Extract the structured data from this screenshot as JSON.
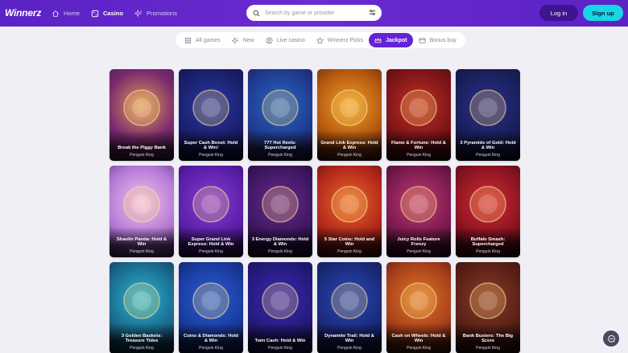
{
  "header": {
    "logo": "Winnerz",
    "nav": [
      {
        "label": "Home",
        "icon": "home-icon",
        "active": false
      },
      {
        "label": "Casino",
        "icon": "casino-icon",
        "active": true
      },
      {
        "label": "Promotions",
        "icon": "sparkle-icon",
        "active": false
      }
    ],
    "search_placeholder": "Search by game or provider",
    "login_label": "Log in",
    "signup_label": "Sign up"
  },
  "tabs": [
    {
      "label": "All games",
      "icon": "grid-icon",
      "active": false
    },
    {
      "label": "New",
      "icon": "sparkle-icon",
      "active": false
    },
    {
      "label": "Live casino",
      "icon": "live-icon",
      "active": false
    },
    {
      "label": "Winnerz Picks",
      "icon": "star-icon",
      "active": false
    },
    {
      "label": "Jackpot",
      "icon": "crown-icon",
      "active": true
    },
    {
      "label": "Bonus buy",
      "icon": "card-icon",
      "active": false
    }
  ],
  "games": [
    {
      "title": "Break the Piggy Bank",
      "provider": "Penguin King",
      "colors": [
        "#e09a5a",
        "#7a2a6e",
        "#3d1a4a"
      ]
    },
    {
      "title": "Super Cash Boost: Hold & Win!",
      "provider": "Penguin King",
      "colors": [
        "#2b3aa8",
        "#1a1f6b",
        "#10113c"
      ]
    },
    {
      "title": "777 Hot Reels: Supercharged",
      "provider": "Penguin King",
      "colors": [
        "#2a68c8",
        "#1f3b8e",
        "#2a1240"
      ]
    },
    {
      "title": "Grand Link Express: Hold & Win",
      "provider": "Penguin King",
      "colors": [
        "#f2a12a",
        "#b4570f",
        "#4a1d0a"
      ]
    },
    {
      "title": "Flame & Fortune: Hold & Win",
      "provider": "Penguin King",
      "colors": [
        "#c23226",
        "#7d1418",
        "#3a0a0c"
      ]
    },
    {
      "title": "3 Pyramids of Gold: Hold & Win",
      "provider": "Penguin King",
      "colors": [
        "#2e2e8a",
        "#18205a",
        "#0e1233"
      ]
    },
    {
      "title": "Shaolin Panda: Hold & Win",
      "provider": "Penguin King",
      "colors": [
        "#f2c2ec",
        "#b57ad6",
        "#4b2a75"
      ]
    },
    {
      "title": "Super Grand Link Express: Hold & Win",
      "provider": "Penguin King",
      "colors": [
        "#8a3dd6",
        "#5a1fa8",
        "#2a0f5c"
      ]
    },
    {
      "title": "3 Energy Diamonds: Hold & Win",
      "provider": "Penguin King",
      "colors": [
        "#6b2a8e",
        "#3d1760",
        "#1b0a33"
      ]
    },
    {
      "title": "5 Star Coins: Hold and Win",
      "provider": "Penguin King",
      "colors": [
        "#e86a2a",
        "#b3281a",
        "#4a0a0a"
      ]
    },
    {
      "title": "Juicy Rolls Feature Frenzy",
      "provider": "Penguin King",
      "colors": [
        "#c23a72",
        "#7a1a4e",
        "#2a0a22"
      ]
    },
    {
      "title": "Buffalo Smash: Supercharged",
      "provider": "Penguin King",
      "colors": [
        "#d62a3a",
        "#8a1420",
        "#3a0a10"
      ]
    },
    {
      "title": "3 Golden Baskets: Treasure Tides",
      "provider": "Penguin King",
      "colors": [
        "#2ab8d6",
        "#1a6a8e",
        "#0e2a3c"
      ]
    },
    {
      "title": "Coins & Diamonds: Hold & Win",
      "provider": "Penguin King",
      "colors": [
        "#2a5fd6",
        "#1a3a9e",
        "#0c1a4a"
      ]
    },
    {
      "title": "Twin Cash: Hold & Win",
      "provider": "Penguin King",
      "colors": [
        "#3a2ab8",
        "#241a7a",
        "#120c3c"
      ]
    },
    {
      "title": "Dynamite Trail: Hold & Win",
      "provider": "Penguin King",
      "colors": [
        "#2a4ab8",
        "#1a2a7a",
        "#0e143c"
      ]
    },
    {
      "title": "Cash on Wheels: Hold & Win",
      "provider": "Penguin King",
      "colors": [
        "#e0782a",
        "#a8401a",
        "#3a140a"
      ]
    },
    {
      "title": "Bank Busters: The Big Score",
      "provider": "Penguin King",
      "colors": [
        "#8a3a2a",
        "#5a2016",
        "#2a0e0a"
      ]
    }
  ]
}
